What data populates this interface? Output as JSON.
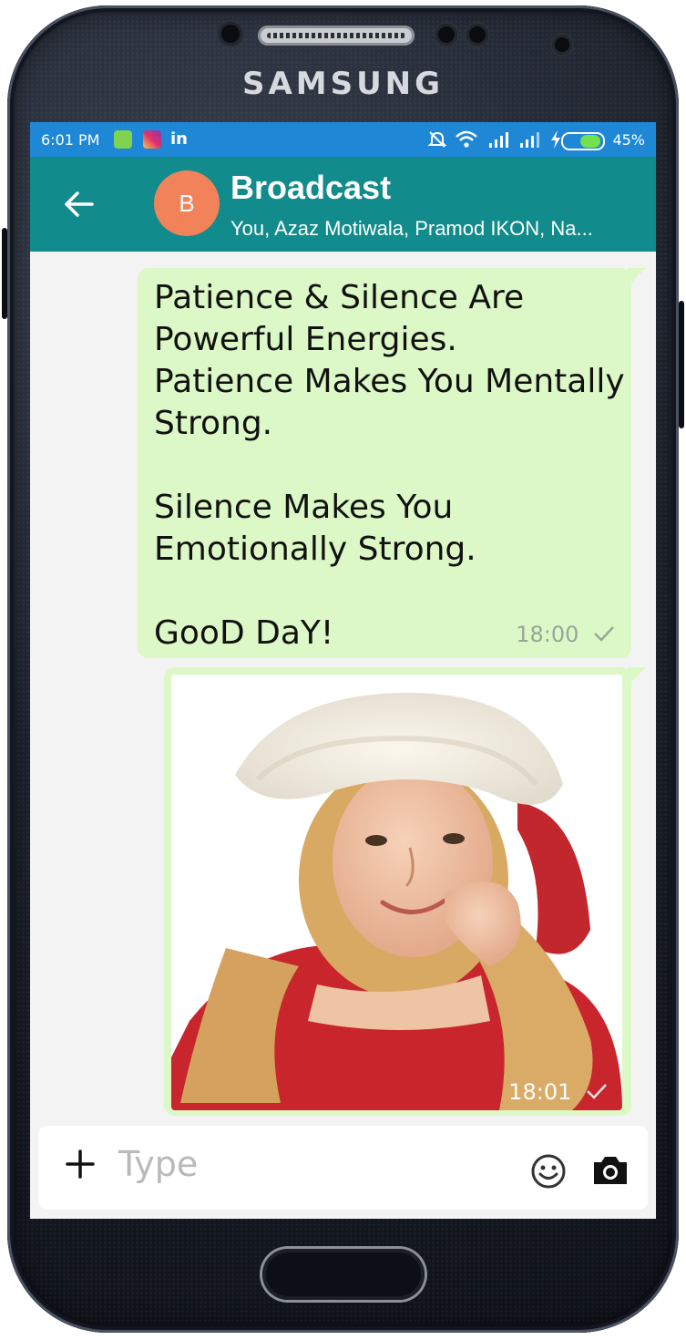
{
  "device": {
    "brand": "SAMSUNG"
  },
  "status_bar": {
    "time": "6:01 PM",
    "battery": "45%",
    "icons": [
      "android-icon",
      "instagram-icon",
      "linkedin-icon",
      "mute-icon",
      "wifi-icon",
      "signal-icon",
      "signal-icon",
      "charging-icon",
      "battery-icon"
    ],
    "linkedin_label": "in"
  },
  "chat": {
    "avatar_letter": "B",
    "title": "Broadcast",
    "subtitle": "You, Azaz Motiwala, Pramod IKON, Na..."
  },
  "messages": [
    {
      "type": "text",
      "text": "Patience & Silence Are\nPowerful Energies.\nPatience Makes You Mentally\nStrong.\n\nSilence Makes You\nEmotionally Strong.\n\nGooD DaY!",
      "time": "18:00",
      "status": "sent"
    },
    {
      "type": "image",
      "time": "18:01",
      "status": "sent"
    }
  ],
  "input": {
    "placeholder": "Type"
  },
  "colors": {
    "status_bar": "#1e88d6",
    "app_bar": "#118b8b",
    "avatar": "#f1825a",
    "bubble": "#dcf8c6",
    "background": "#f3f3f3"
  }
}
